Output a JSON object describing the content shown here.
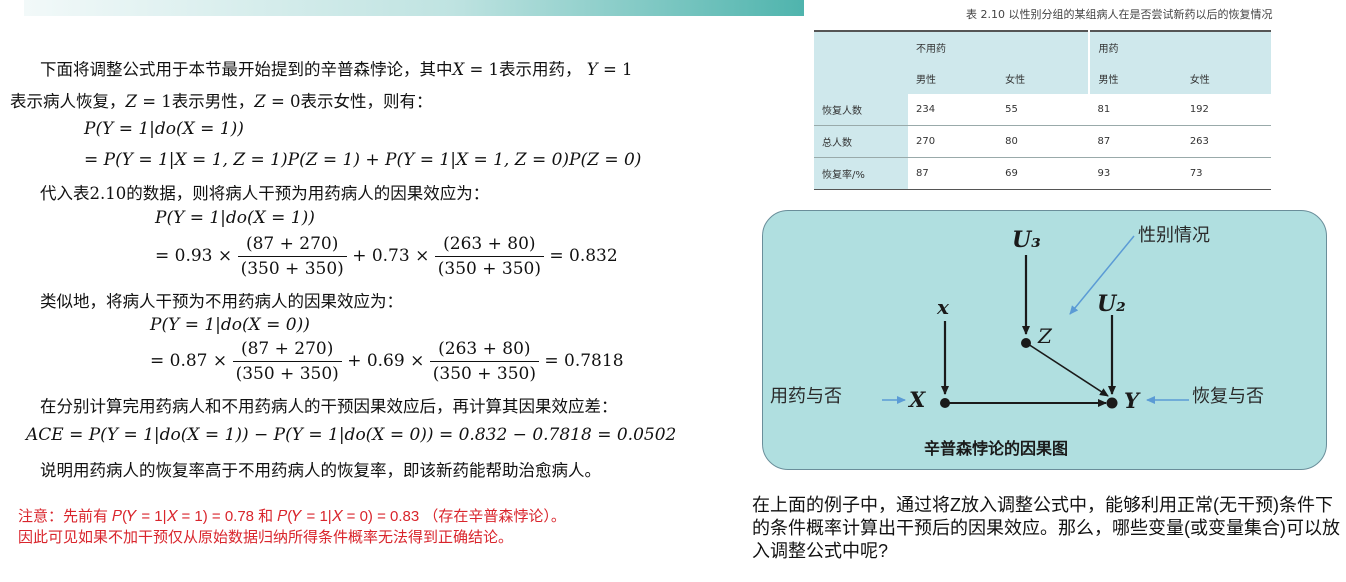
{
  "text": {
    "intro_line1": "下面将调整公式用于本节最开始提到的辛普森悖论，其中𝑋 = 1表示用药， 𝑌 = 1",
    "intro_line2": "表示病人恢复，𝑍 = 1表示男性，𝑍 = 0表示女性，则有：",
    "eq1a": "𝑃(𝑌 = 1|𝑑𝑜(𝑋 = 1))",
    "eq1b": "= 𝑃(𝑌 = 1|𝑋 = 1, 𝑍 = 1)𝑃(𝑍 = 1) + 𝑃(𝑌 = 1|𝑋 = 1, 𝑍 = 0)𝑃(𝑍 = 0)",
    "para2": "代入表2.10的数据，则将病人干预为用药病人的因果效应为：",
    "eq2a": "𝑃(𝑌 = 1|𝑑𝑜(𝑋 = 1))",
    "eq2_lead": "= 0.93 ×",
    "eq2_f1_num": "(87 + 270)",
    "eq2_f1_den": "(350 + 350)",
    "eq2_mid": "+ 0.73 ×",
    "eq2_f2_num": "(263 + 80)",
    "eq2_f2_den": "(350 + 350)",
    "eq2_result": "= 0.832",
    "para3": "类似地，将病人干预为不用药病人的因果效应为：",
    "eq3a": "𝑃(𝑌 = 1|𝑑𝑜(𝑋 = 0))",
    "eq3_lead": "= 0.87 ×",
    "eq3_f1_num": "(87 + 270)",
    "eq3_f1_den": "(350 + 350)",
    "eq3_mid": "+ 0.69 ×",
    "eq3_f2_num": "(263 + 80)",
    "eq3_f2_den": "(350 + 350)",
    "eq3_result": "= 0.7818",
    "para4": "在分别计算完用药病人和不用药病人的干预因果效应后，再计算其因果效应差：",
    "eq4": "𝐴𝐶𝐸 = 𝑃(𝑌 = 1|𝑑𝑜(𝑋 = 1)) − 𝑃(𝑌 = 1|𝑑𝑜(𝑋 = 0)) = 0.832 − 0.7818 = 0.0502",
    "para5": "说明用药病人的恢复率高于不用药病人的恢复率，即该新药能帮助治愈病人。",
    "note_line1": "注意：先前有 𝑃(𝑌 = 1|𝑋 = 1) = 0.78 和  𝑃(𝑌 = 1|𝑋 = 0) = 0.83 （存在辛普森悖论）。",
    "note_line2": "因此可见如果不加干预仅从原始数据归纳所得条件概率无法得到正确结论。",
    "bottom_question": "在上面的例子中，通过将Z放入调整公式中，能够利用正常(无干预)条件下的条件概率计算出干预后的因果效应。那么，哪些变量(或变量集合)可以放入调整公式中呢?"
  },
  "table": {
    "caption": "表 2.10   以性别分组的某组病人在是否尝试新药以后的恢复情况",
    "groups": [
      "不用药",
      "用药"
    ],
    "subheaders": [
      "男性",
      "女性",
      "男性",
      "女性"
    ],
    "rows": [
      {
        "label": "恢复人数",
        "values": [
          "234",
          "55",
          "81",
          "192"
        ]
      },
      {
        "label": "总人数",
        "values": [
          "270",
          "80",
          "87",
          "263"
        ]
      },
      {
        "label": "恢复率/%",
        "values": [
          "87",
          "69",
          "93",
          "73"
        ]
      }
    ]
  },
  "diagram": {
    "title": "辛普森悖论的因果图",
    "nodes": {
      "u3": "U₃",
      "u2": "U₂",
      "x_small": "x",
      "z": "Z",
      "x": "X",
      "y": "Y"
    },
    "annotations": {
      "gender": "性别情况",
      "drug": "用药与否",
      "recovery": "恢复与否"
    },
    "colors": {
      "arrow_blue": "#5b9bd5",
      "node_dark": "#1a1a1a",
      "box_fill": "#b0dfe0"
    }
  },
  "colors": {
    "note_red": "#d9252c",
    "topbar_teal": "#4fb4ad"
  }
}
